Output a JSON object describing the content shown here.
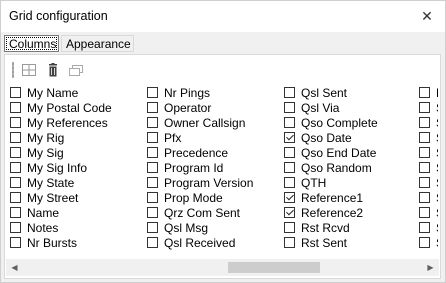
{
  "window": {
    "title": "Grid configuration",
    "close_glyph": "✕"
  },
  "tabs": [
    {
      "label": "Columns",
      "active": true
    },
    {
      "label": "Appearance",
      "active": false
    }
  ],
  "toolbar": {
    "icons": [
      "grid-layout-icon",
      "delete-icon",
      "restore-icon"
    ]
  },
  "columns": [
    [
      {
        "label": "My Name",
        "checked": false
      },
      {
        "label": "My Postal Code",
        "checked": false
      },
      {
        "label": "My References",
        "checked": false
      },
      {
        "label": "My Rig",
        "checked": false
      },
      {
        "label": "My Sig",
        "checked": false
      },
      {
        "label": "My Sig Info",
        "checked": false
      },
      {
        "label": "My State",
        "checked": false
      },
      {
        "label": "My Street",
        "checked": false
      },
      {
        "label": "Name",
        "checked": true
      },
      {
        "label": "Notes",
        "checked": false
      },
      {
        "label": "Nr Bursts",
        "checked": false
      }
    ],
    [
      {
        "label": "Nr Pings",
        "checked": false
      },
      {
        "label": "Operator",
        "checked": false
      },
      {
        "label": "Owner Callsign",
        "checked": false
      },
      {
        "label": "Pfx",
        "checked": false
      },
      {
        "label": "Precedence",
        "checked": false
      },
      {
        "label": "Program Id",
        "checked": false
      },
      {
        "label": "Program Version",
        "checked": false
      },
      {
        "label": "Prop Mode",
        "checked": false
      },
      {
        "label": "Qrz Com Sent",
        "checked": false
      },
      {
        "label": "Qsl Msg",
        "checked": false
      },
      {
        "label": "Qsl Received",
        "checked": false
      }
    ],
    [
      {
        "label": "Qsl Sent",
        "checked": false
      },
      {
        "label": "Qsl Via",
        "checked": false
      },
      {
        "label": "Qso Complete",
        "checked": false
      },
      {
        "label": "Qso Date",
        "checked": true
      },
      {
        "label": "Qso End Date",
        "checked": false
      },
      {
        "label": "Qso Random",
        "checked": false
      },
      {
        "label": "QTH",
        "checked": false
      },
      {
        "label": "Reference1",
        "checked": true
      },
      {
        "label": "Reference2",
        "checked": true
      },
      {
        "label": "Rst Rcvd",
        "checked": false
      },
      {
        "label": "Rst Sent",
        "checked": false
      }
    ],
    [
      {
        "label": "R",
        "checked": false
      },
      {
        "label": "S",
        "checked": false
      },
      {
        "label": "S",
        "checked": false
      },
      {
        "label": "S",
        "checked": false
      },
      {
        "label": "S",
        "checked": false
      },
      {
        "label": "S",
        "checked": false
      },
      {
        "label": "S",
        "checked": false
      },
      {
        "label": "S",
        "checked": false
      },
      {
        "label": "S",
        "checked": false
      },
      {
        "label": "S",
        "checked": false
      },
      {
        "label": "S",
        "checked": false
      }
    ]
  ],
  "scrollbar": {
    "left_arrow": "◀",
    "right_arrow": "▶"
  }
}
